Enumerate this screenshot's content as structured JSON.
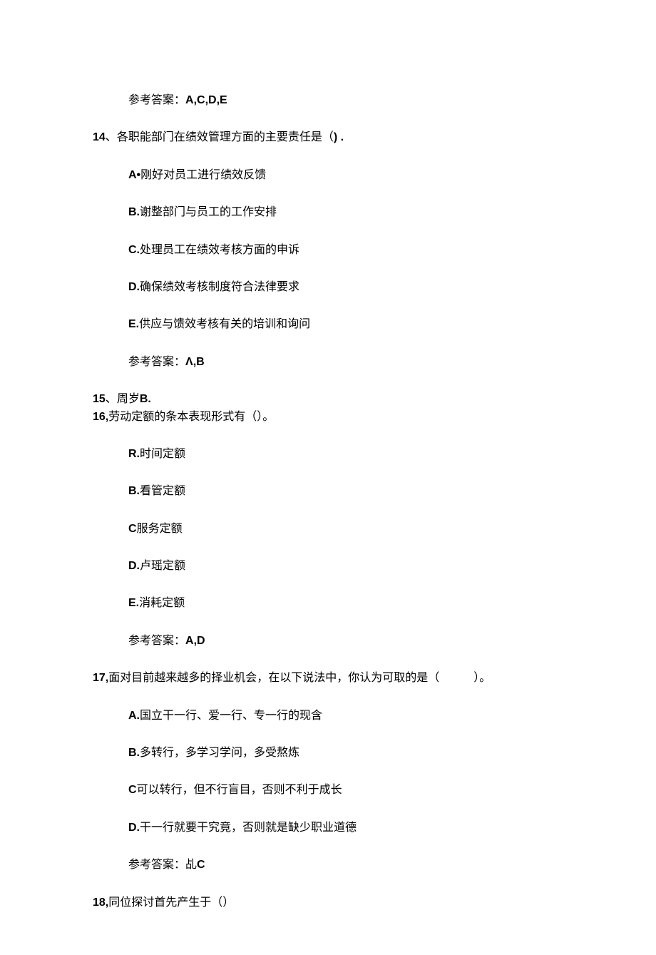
{
  "q13_answer_label": "参考答案：",
  "q13_answer_value": "A,C,D,E",
  "q14_num": "14",
  "q14_sep": "、",
  "q14_text": "各职能部门在绩效管理方面的主要责任是（",
  "q14_paren": ") .",
  "q14_optA_label": "A•",
  "q14_optA_text": "刚好对员工进行绩效反馈",
  "q14_optB_label": "B.",
  "q14_optB_text": "谢整部门与员工的工作安排",
  "q14_optC_label": "C.",
  "q14_optC_text": "处理员工在绩效考核方面的申诉",
  "q14_optD_label": "D.",
  "q14_optD_text": "确保绩效考核制度符合法律要求",
  "q14_optE_label": "E.",
  "q14_optE_text": "供应与馈效考核有关的培训和询问",
  "q14_answer_label": "参考答案：",
  "q14_answer_value": "Λ,B",
  "q15_num": "15",
  "q15_sep": "、",
  "q15_text_pre": "周岁",
  "q15_text_bold": "B.",
  "q16_num": "16,",
  "q16_text": "劳动定额的条本表现形式有（）。",
  "q16_optR_label": "R.",
  "q16_optR_text": "时间定额",
  "q16_optB_label": "B.",
  "q16_optB_text": "看管定额",
  "q16_optC_label": "C",
  "q16_optC_text": "服务定额",
  "q16_optD_label": "D.",
  "q16_optD_text": "卢瑶定额",
  "q16_optE_label": "E.",
  "q16_optE_text": "消耗定额",
  "q16_answer_label": "参考答案：",
  "q16_answer_value": "A,D",
  "q17_num": "17,",
  "q17_text": "面对目前越来越多的择业机会，在以下说法中，你认为可取的是（　　　）。",
  "q17_optA_label": "A.",
  "q17_optA_text": "国立干一行、爱一行、专一行的现含",
  "q17_optB_label": "B.",
  "q17_optB_text": "多转行，多学习学问，多受熬炼",
  "q17_optC_label": "C",
  "q17_optC_text": "可以转行，但不行盲目，否则不利于成长",
  "q17_optD_label": "D.",
  "q17_optD_text": "干一行就要干究竟，否则就是缺少职业道德",
  "q17_answer_label": "参考答案：乩",
  "q17_answer_value": "C",
  "q18_num": "18,",
  "q18_text": "同位探讨首先产生于（）"
}
